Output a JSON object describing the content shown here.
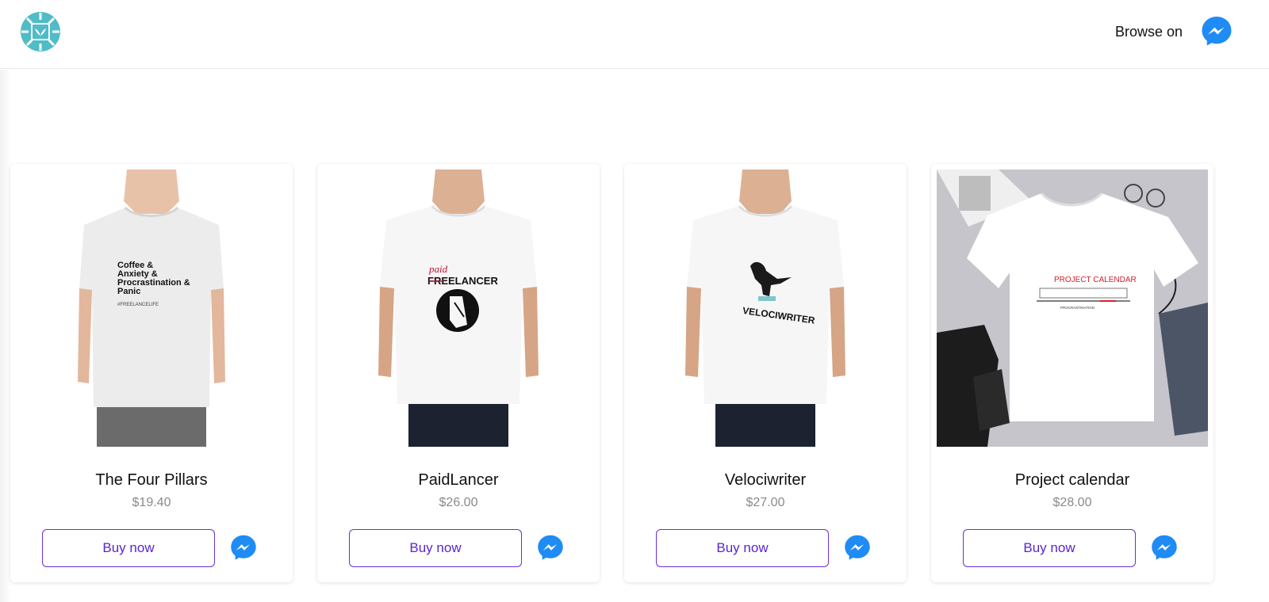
{
  "header": {
    "logo_icon": "leaf-seal-logo-icon",
    "browse_label": "Browse on",
    "messenger_icon": "messenger-icon"
  },
  "colors": {
    "accent": "#5a24d4",
    "messenger_blue": "#1f8bf5",
    "logo_teal": "#4fbcc7",
    "price_gray": "#8a8a8a"
  },
  "products": [
    {
      "title": "The Four Pillars",
      "price": "$19.40",
      "buy_label": "Buy now",
      "image_icon": "tshirt-model-icon",
      "print_lines": [
        "Coffee &",
        "Anxiety &",
        "Procrastination &",
        "Panic"
      ],
      "print_tag": "#FREELANCELIFE"
    },
    {
      "title": "PaidLancer",
      "price": "$26.00",
      "buy_label": "Buy now",
      "image_icon": "tshirt-model-icon",
      "print_small": "paid",
      "print_main": "FREELANCER"
    },
    {
      "title": "Velociwriter",
      "price": "$27.00",
      "buy_label": "Buy now",
      "image_icon": "tshirt-model-icon",
      "print_main": "VELOCIWRITER"
    },
    {
      "title": "Project calendar",
      "price": "$28.00",
      "buy_label": "Buy now",
      "image_icon": "tshirt-flatlay-icon",
      "print_main": "PROJECT CALENDAR",
      "print_sub": "PROCRASTINATION"
    }
  ]
}
